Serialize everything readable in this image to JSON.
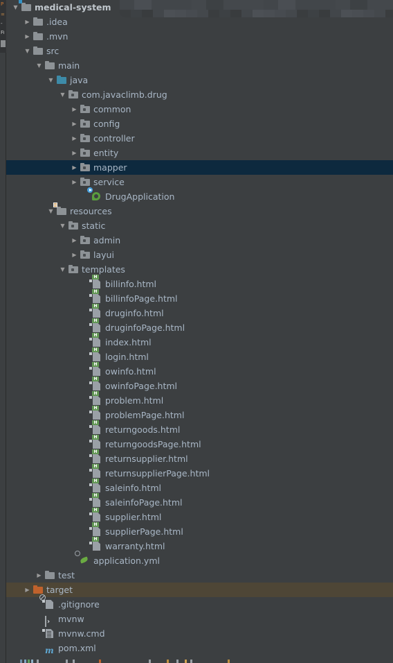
{
  "app": {
    "panel_title": "Project",
    "background_color": "#3c3f41",
    "selection_color": "#0d293e",
    "hover_color": "#4e4636",
    "text_color": "#a9b7c6"
  },
  "toolstrip": {
    "glyphs": [
      "P-icon",
      "structure-icon",
      "favorites-icon",
      "filter-icon"
    ],
    "swatch_name": "tool-swatch"
  },
  "blurred_region": {
    "name": "redacted-toolbar-area",
    "note": "pixelated"
  },
  "tree": {
    "rows": [
      {
        "label": "medical-system",
        "depth": 0,
        "twisty": "▼",
        "icon": "module-folder",
        "style": "root"
      },
      {
        "label": ".idea",
        "depth": 1,
        "twisty": "▶",
        "icon": "folder-grey",
        "style": ""
      },
      {
        "label": ".mvn",
        "depth": 1,
        "twisty": "▶",
        "icon": "folder-grey",
        "style": ""
      },
      {
        "label": "src",
        "depth": 1,
        "twisty": "▼",
        "icon": "folder-grey",
        "style": ""
      },
      {
        "label": "main",
        "depth": 2,
        "twisty": "▼",
        "icon": "folder-grey",
        "style": ""
      },
      {
        "label": "java",
        "depth": 3,
        "twisty": "▼",
        "icon": "folder-source",
        "style": ""
      },
      {
        "label": "com.javaclimb.drug",
        "depth": 4,
        "twisty": "▼",
        "icon": "folder-package",
        "style": ""
      },
      {
        "label": "common",
        "depth": 5,
        "twisty": "▶",
        "icon": "folder-package",
        "style": ""
      },
      {
        "label": "config",
        "depth": 5,
        "twisty": "▶",
        "icon": "folder-package",
        "style": ""
      },
      {
        "label": "controller",
        "depth": 5,
        "twisty": "▶",
        "icon": "folder-package",
        "style": ""
      },
      {
        "label": "entity",
        "depth": 5,
        "twisty": "▶",
        "icon": "folder-package",
        "style": ""
      },
      {
        "label": "mapper",
        "depth": 5,
        "twisty": "▶",
        "icon": "folder-package",
        "style": "selected"
      },
      {
        "label": "service",
        "depth": 5,
        "twisty": "▶",
        "icon": "folder-package",
        "style": ""
      },
      {
        "label": "DrugApplication",
        "depth": 6,
        "twisty": "",
        "icon": "spring-boot-class",
        "style": ""
      },
      {
        "label": "resources",
        "depth": 3,
        "twisty": "▼",
        "icon": "folder-resources",
        "style": ""
      },
      {
        "label": "static",
        "depth": 4,
        "twisty": "▼",
        "icon": "folder-package",
        "style": ""
      },
      {
        "label": "admin",
        "depth": 5,
        "twisty": "▶",
        "icon": "folder-package",
        "style": ""
      },
      {
        "label": "layui",
        "depth": 5,
        "twisty": "▶",
        "icon": "folder-package",
        "style": ""
      },
      {
        "label": "templates",
        "depth": 4,
        "twisty": "▼",
        "icon": "folder-package",
        "style": ""
      },
      {
        "label": "billinfo.html",
        "depth": 6,
        "twisty": "",
        "icon": "html-file",
        "style": ""
      },
      {
        "label": "billinfoPage.html",
        "depth": 6,
        "twisty": "",
        "icon": "html-file",
        "style": ""
      },
      {
        "label": "druginfo.html",
        "depth": 6,
        "twisty": "",
        "icon": "html-file",
        "style": ""
      },
      {
        "label": "druginfoPage.html",
        "depth": 6,
        "twisty": "",
        "icon": "html-file",
        "style": ""
      },
      {
        "label": "index.html",
        "depth": 6,
        "twisty": "",
        "icon": "html-file",
        "style": ""
      },
      {
        "label": "login.html",
        "depth": 6,
        "twisty": "",
        "icon": "html-file",
        "style": ""
      },
      {
        "label": "owinfo.html",
        "depth": 6,
        "twisty": "",
        "icon": "html-file",
        "style": ""
      },
      {
        "label": "owinfoPage.html",
        "depth": 6,
        "twisty": "",
        "icon": "html-file",
        "style": ""
      },
      {
        "label": "problem.html",
        "depth": 6,
        "twisty": "",
        "icon": "html-file",
        "style": ""
      },
      {
        "label": "problemPage.html",
        "depth": 6,
        "twisty": "",
        "icon": "html-file",
        "style": ""
      },
      {
        "label": "returngoods.html",
        "depth": 6,
        "twisty": "",
        "icon": "html-file",
        "style": ""
      },
      {
        "label": "returngoodsPage.html",
        "depth": 6,
        "twisty": "",
        "icon": "html-file",
        "style": ""
      },
      {
        "label": "returnsupplier.html",
        "depth": 6,
        "twisty": "",
        "icon": "html-file",
        "style": ""
      },
      {
        "label": "returnsupplierPage.html",
        "depth": 6,
        "twisty": "",
        "icon": "html-file",
        "style": ""
      },
      {
        "label": "saleinfo.html",
        "depth": 6,
        "twisty": "",
        "icon": "html-file",
        "style": ""
      },
      {
        "label": "saleinfoPage.html",
        "depth": 6,
        "twisty": "",
        "icon": "html-file",
        "style": ""
      },
      {
        "label": "supplier.html",
        "depth": 6,
        "twisty": "",
        "icon": "html-file",
        "style": ""
      },
      {
        "label": "supplierPage.html",
        "depth": 6,
        "twisty": "",
        "icon": "html-file",
        "style": ""
      },
      {
        "label": "warranty.html",
        "depth": 6,
        "twisty": "",
        "icon": "html-file",
        "style": ""
      },
      {
        "label": "application.yml",
        "depth": 5,
        "twisty": "",
        "icon": "yml-spring-file",
        "style": ""
      },
      {
        "label": "test",
        "depth": 2,
        "twisty": "▶",
        "icon": "folder-grey",
        "style": ""
      },
      {
        "label": "target",
        "depth": 1,
        "twisty": "▶",
        "icon": "folder-excluded",
        "style": "hovered"
      },
      {
        "label": ".gitignore",
        "depth": 2,
        "twisty": "",
        "icon": "gitignore-file",
        "style": ""
      },
      {
        "label": "mvnw",
        "depth": 2,
        "twisty": "",
        "icon": "script-file",
        "style": ""
      },
      {
        "label": "mvnw.cmd",
        "depth": 2,
        "twisty": "",
        "icon": "text-file",
        "style": ""
      },
      {
        "label": "pom.xml",
        "depth": 2,
        "twisty": "",
        "icon": "maven-file",
        "style": ""
      }
    ]
  }
}
